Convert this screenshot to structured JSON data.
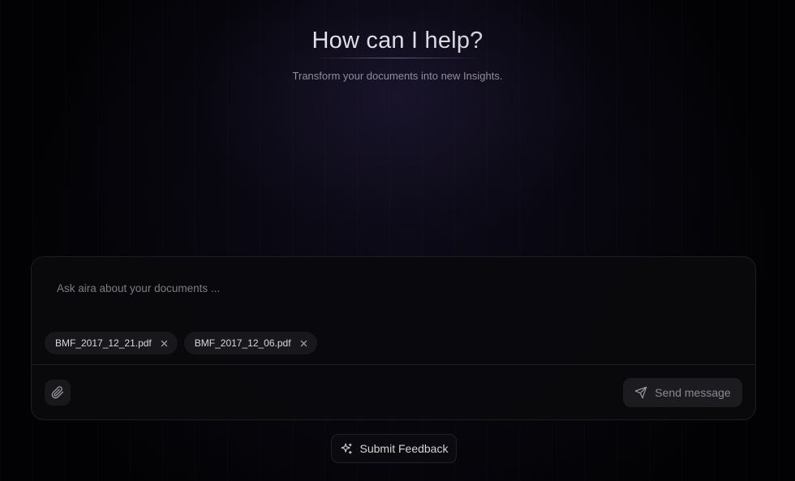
{
  "hero": {
    "title": "How can I help?",
    "subtitle": "Transform your documents into new Insights."
  },
  "composer": {
    "placeholder": "Ask aira about your documents ...",
    "value": "",
    "attachments": [
      {
        "name": "BMF_2017_12_21.pdf",
        "remove_icon": "close-icon"
      },
      {
        "name": "BMF_2017_12_06.pdf",
        "remove_icon": "close-icon"
      }
    ],
    "attach_icon": "paperclip-icon",
    "send_label": "Send message",
    "send_icon": "send-icon"
  },
  "feedback": {
    "label": "Submit Feedback",
    "icon": "sparkles-icon"
  }
}
